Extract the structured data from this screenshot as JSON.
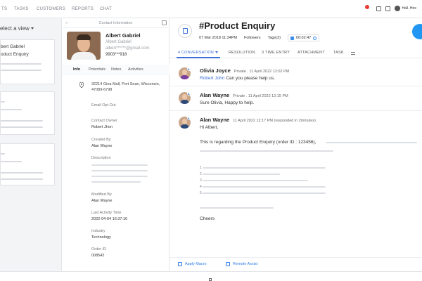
{
  "nav": {
    "items": [
      "TS",
      "TASKS",
      "CUSTOMERS",
      "REPORTS",
      "CHAT"
    ],
    "user_label": "Hall. Hire"
  },
  "left": {
    "select_view": "elect a view",
    "cards": [
      {
        "line1": "bert Gabriel",
        "line2": "oduct Enquiry"
      }
    ]
  },
  "contact": {
    "header_title": "Contact Information",
    "name": "Albert Gabriel",
    "company": "Albert Gabriel",
    "email": "albert******@gmail.com",
    "phone": "9903***918",
    "tabs": [
      "Info",
      "Potentials",
      "Notes",
      "Activities"
    ],
    "address": "32214 Gina Mall, Port Sean, Wisconsin, 47089-6798",
    "fields": [
      {
        "label": "Email Opt Out",
        "value": ""
      },
      {
        "label": "Contact Owner",
        "value": "Robert Jhon"
      },
      {
        "label": "Created By",
        "value": "Alan Wayne"
      },
      {
        "label": "Description",
        "value": ""
      },
      {
        "label": "Modified By",
        "value": "Alan Wayne"
      },
      {
        "label": "Last Activity Time",
        "value": "2022-04-04 16:37:16"
      },
      {
        "label": "Industry",
        "value": "Technology"
      },
      {
        "label": "Order ID",
        "value": "008542"
      }
    ]
  },
  "ticket": {
    "title": "#Product Enquiry",
    "date": "07 Mar 2018 11:34PM",
    "followers": "Followers",
    "tags": "Tags(3)",
    "timer": "00:02:47",
    "tabs": [
      "4 CONVERSATION",
      "RESOLUTION",
      "3 TIME ENTRY",
      "ATTACHMENT",
      "TASK"
    ]
  },
  "messages": [
    {
      "name": "Olivia Joyce",
      "meta": "Private . 11 April 2022  12:02 PM",
      "mention": "Robert John",
      "body": "Can you please help us."
    },
    {
      "name": "Alan Wayne",
      "meta": "Private . 11 April 2022  12:15 PM",
      "body": "Sure Olivia, Happy to help."
    },
    {
      "name": "Alan Wayne",
      "meta": "11 April 2022  12:17 PM  (responded in 2minutes)",
      "greeting": "Hi Albert,",
      "line": "This is regarding the Product Enquiry (order ID : 123456),",
      "closing": "Cheers"
    }
  ],
  "footer": {
    "apply_macro": "Apply Macro",
    "remote_assist": "Remote Assist"
  }
}
